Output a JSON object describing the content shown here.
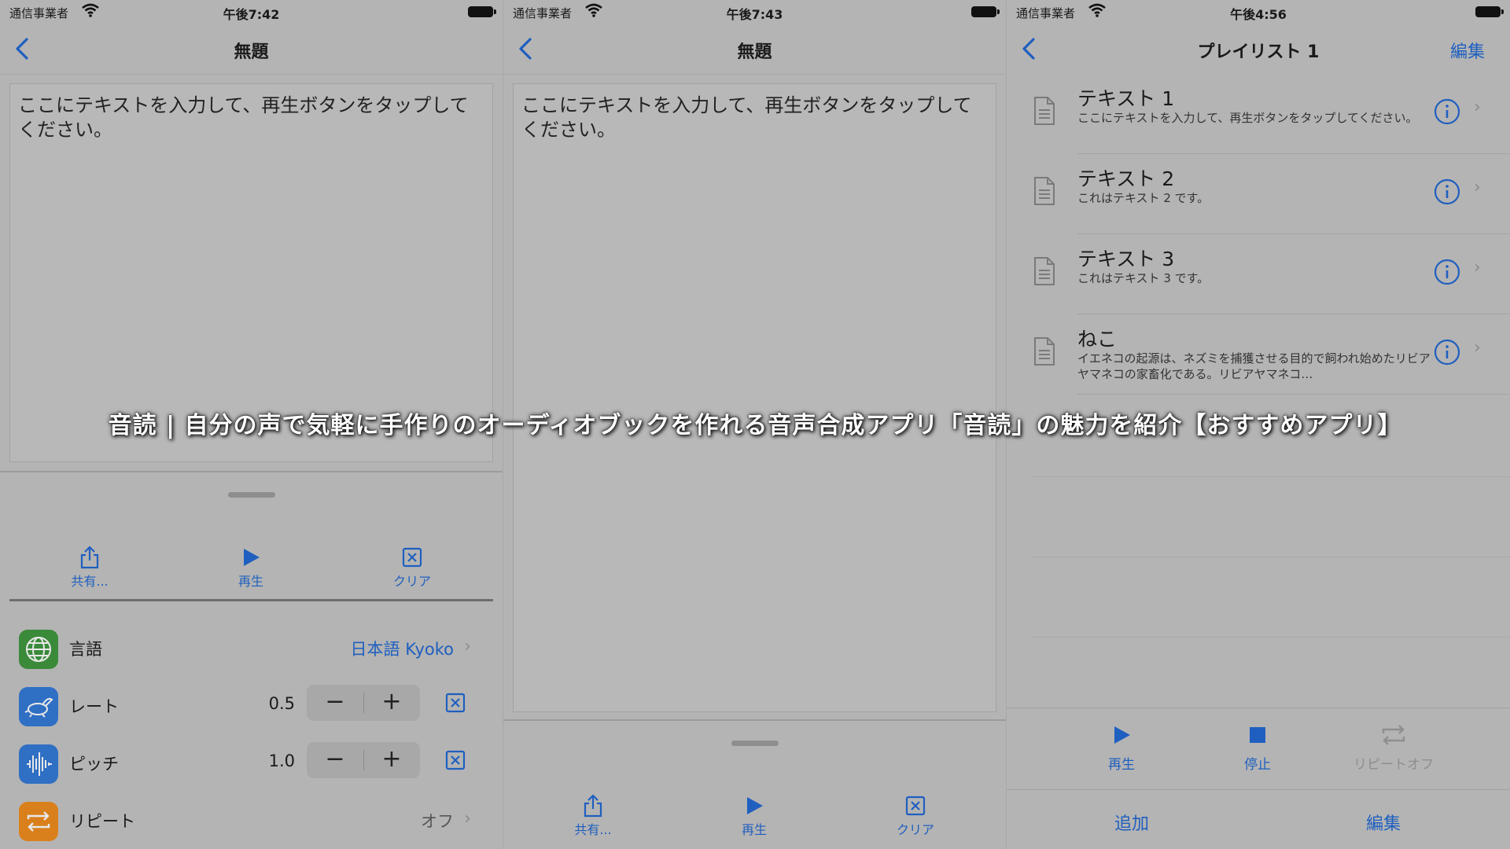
{
  "overlay": {
    "title": "音読 | 自分の声で気軽に手作りのオーディオブックを作れる音声合成アプリ「音読」の魅力を紹介【おすすめアプリ】"
  },
  "colors": {
    "accent": "#1f5fbf",
    "background": "#b4b4b4",
    "green_icon": "#3a8a3a",
    "blue_icon": "#2f6fc4",
    "orange_icon": "#d9801c"
  },
  "screens": [
    {
      "status": {
        "carrier": "通信事業者",
        "time": "午後7:42"
      },
      "nav": {
        "title": "無題",
        "back_icon": "chevron-left-icon"
      },
      "editor": {
        "text": "ここにテキストを入力して、再生ボタンをタップしてください。"
      },
      "toolbar": [
        {
          "label": "共有...",
          "icon": "share-icon"
        },
        {
          "label": "再生",
          "icon": "play-icon"
        },
        {
          "label": "クリア",
          "icon": "clear-icon"
        }
      ],
      "settings": {
        "language": {
          "label": "言語",
          "value": "日本語 Kyoko",
          "icon": "globe-icon"
        },
        "rate": {
          "label": "レート",
          "value": "0.5",
          "icon": "rabbit-icon"
        },
        "pitch": {
          "label": "ピッチ",
          "value": "1.0",
          "icon": "waveform-icon"
        },
        "repeat": {
          "label": "リピート",
          "value": "オフ",
          "icon": "repeat-icon"
        },
        "stepper": {
          "minus": "−",
          "plus": "+"
        }
      }
    },
    {
      "status": {
        "carrier": "通信事業者",
        "time": "午後7:43"
      },
      "nav": {
        "title": "無題",
        "back_icon": "chevron-left-icon"
      },
      "editor": {
        "text": "ここにテキストを入力して、再生ボタンをタップしてください。"
      },
      "toolbar": [
        {
          "label": "共有...",
          "icon": "share-icon"
        },
        {
          "label": "再生",
          "icon": "play-icon"
        },
        {
          "label": "クリア",
          "icon": "clear-icon"
        }
      ]
    },
    {
      "status": {
        "carrier": "通信事業者",
        "time": "午後4:56"
      },
      "nav": {
        "title": "プレイリスト 1",
        "edit": "編集",
        "back_icon": "chevron-left-icon"
      },
      "items": [
        {
          "title": "テキスト 1",
          "subtitle": "ここにテキストを入力して、再生ボタンをタップしてください。"
        },
        {
          "title": "テキスト 2",
          "subtitle": "これはテキスト 2 です。"
        },
        {
          "title": "テキスト 3",
          "subtitle": "これはテキスト 3 です。"
        },
        {
          "title": "ねこ",
          "subtitle": "イエネコの起源は、ネズミを捕獲させる目的で飼われ始めたリビアヤマネコの家畜化である。リビアヤマネコ…"
        }
      ],
      "player": [
        {
          "label": "再生",
          "icon": "play-icon"
        },
        {
          "label": "停止",
          "icon": "stop-icon"
        },
        {
          "label": "リピートオフ",
          "icon": "repeat-icon"
        }
      ],
      "bottom": {
        "add": "追加",
        "edit": "編集"
      }
    }
  ]
}
